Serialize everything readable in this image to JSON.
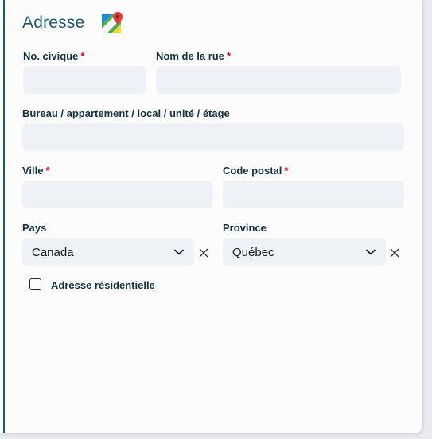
{
  "section": {
    "title": "Adresse",
    "map_icon": "google-maps-icon"
  },
  "fields": {
    "civic_number": {
      "label": "No. civique",
      "required_mark": "*",
      "value": ""
    },
    "street": {
      "label": "Nom de la rue",
      "required_mark": "*",
      "value": ""
    },
    "unit": {
      "label": "Bureau / appartement / local / unité / étage",
      "value": ""
    },
    "city": {
      "label": "Ville",
      "required_mark": "*",
      "value": ""
    },
    "postal_code": {
      "label": "Code postal",
      "required_mark": "*",
      "value": ""
    },
    "country": {
      "label": "Pays",
      "value": "Canada"
    },
    "province": {
      "label": "Province",
      "value": "Québec"
    }
  },
  "residential": {
    "label": "Adresse résidentielle",
    "checked": false
  },
  "colors": {
    "accent": "#0f5f6e",
    "title": "#1d5a6b",
    "required": "#d0021b",
    "input_bg": "#eef2f7"
  }
}
